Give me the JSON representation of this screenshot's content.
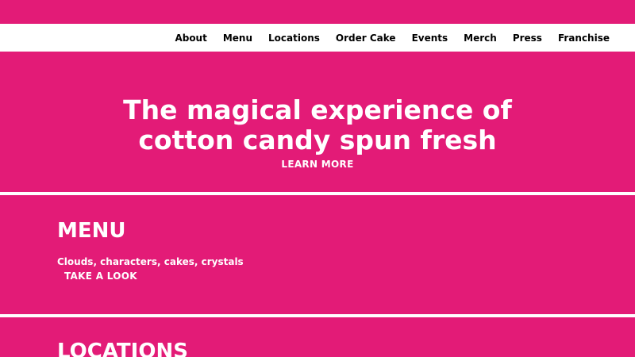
{
  "nav": {
    "items": [
      {
        "label": "About"
      },
      {
        "label": "Menu"
      },
      {
        "label": "Locations"
      },
      {
        "label": "Order Cake"
      },
      {
        "label": "Events"
      },
      {
        "label": "Merch"
      },
      {
        "label": "Press"
      },
      {
        "label": "Franchise"
      }
    ]
  },
  "hero": {
    "title_line1": "The magical experience of",
    "title_line2": "cotton candy spun fresh",
    "cta": "LEARN MORE"
  },
  "menu_section": {
    "title": "MENU",
    "description": "Clouds, characters, cakes, crystals",
    "cta": "TAKE A LOOK"
  },
  "locations_section": {
    "title": "LOCATIONS"
  },
  "colors": {
    "brand_pink": "#e31b77",
    "nav_bg": "#ffffff",
    "nav_text": "#000000"
  }
}
